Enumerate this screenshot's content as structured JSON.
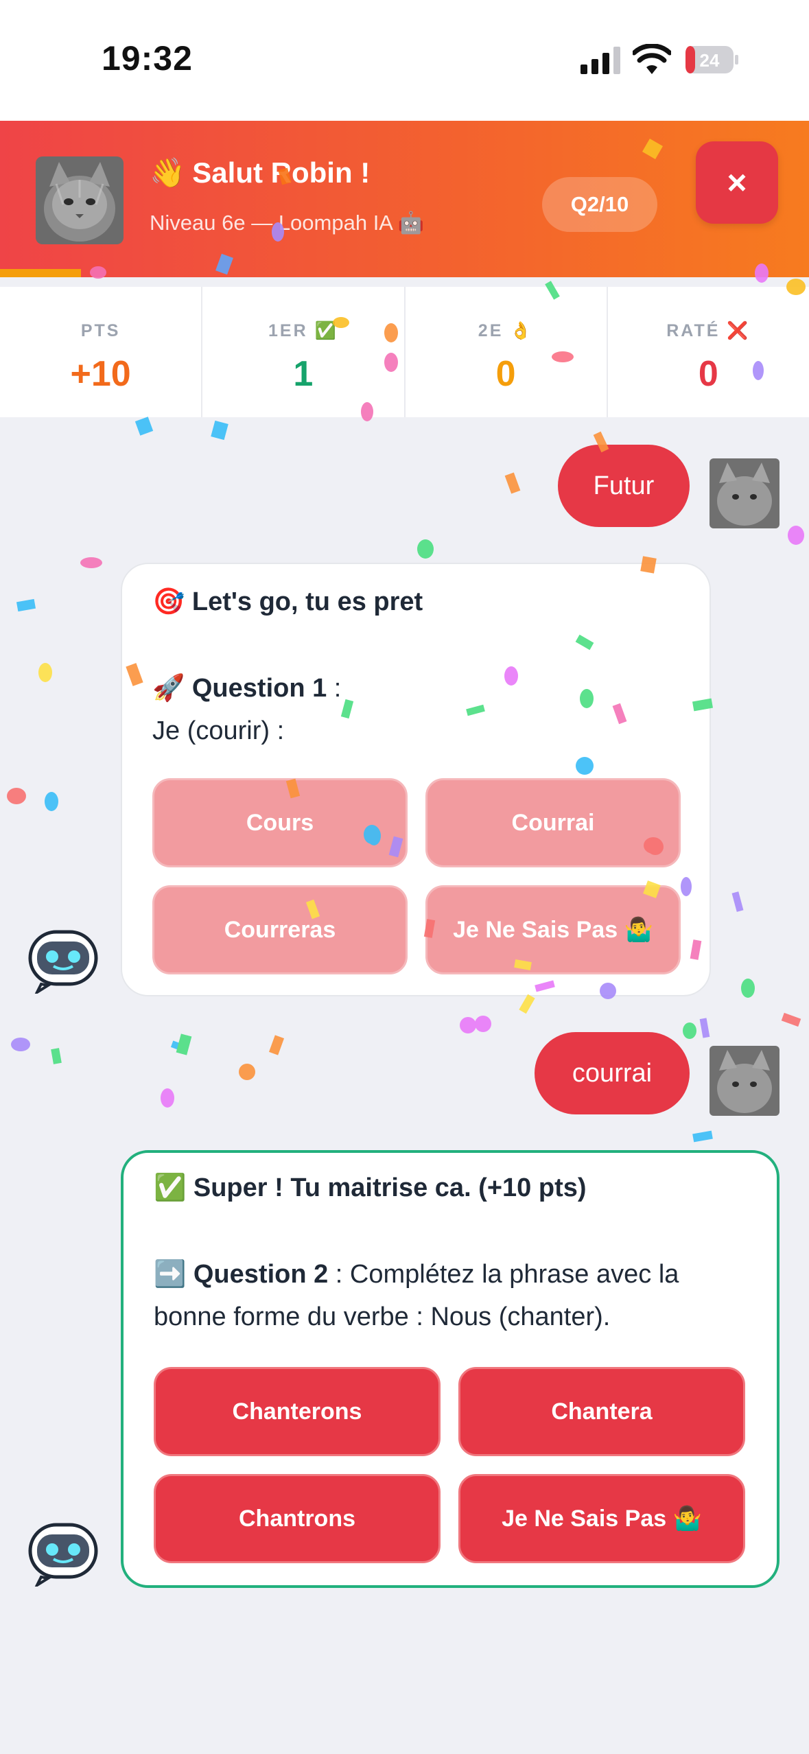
{
  "status": {
    "time": "19:32",
    "battery": "24"
  },
  "header": {
    "greeting_emoji": "👋",
    "greeting": "Salut Robin !",
    "subtitle": "Niveau 6e — Loompah IA 🤖",
    "question_counter": "Q2/10",
    "close_label": "×"
  },
  "stats": [
    {
      "label": "PTS",
      "value": "+10",
      "color": "#f26a1b"
    },
    {
      "label": "1ER ✅",
      "value": "1",
      "color": "#16a36b"
    },
    {
      "label": "2E 👌",
      "value": "0",
      "color": "#f59e0b"
    },
    {
      "label": "RATÉ ❌",
      "value": "0",
      "color": "#e63846"
    }
  ],
  "chat": {
    "user_msg_1": "Futur",
    "card1": {
      "intro": "🎯 Let's go, tu es pret",
      "question_label": "🚀 Question 1",
      "question_sep": " :",
      "question_text": "Je (courir) :",
      "options": [
        "Cours",
        "Courrai",
        "Courreras",
        "Je Ne Sais Pas 🤷‍♂️"
      ]
    },
    "user_msg_2": "courrai",
    "card2": {
      "feedback": "✅ Super ! Tu maitrise ca. (+10 pts)",
      "question_label": "➡️ Question 2",
      "question_text_1": " : Complétez la phrase avec la",
      "question_text_2": "bonne forme du verbe : Nous (chanter).",
      "options": [
        "Chanterons",
        "Chantera",
        "Chantrons",
        "Je Ne Sais Pas 🤷‍♂️"
      ]
    }
  },
  "colors": {
    "accent": "#e63846",
    "correct_border": "#22b07d",
    "header_start": "#ef4447",
    "header_end": "#f77b1f"
  }
}
